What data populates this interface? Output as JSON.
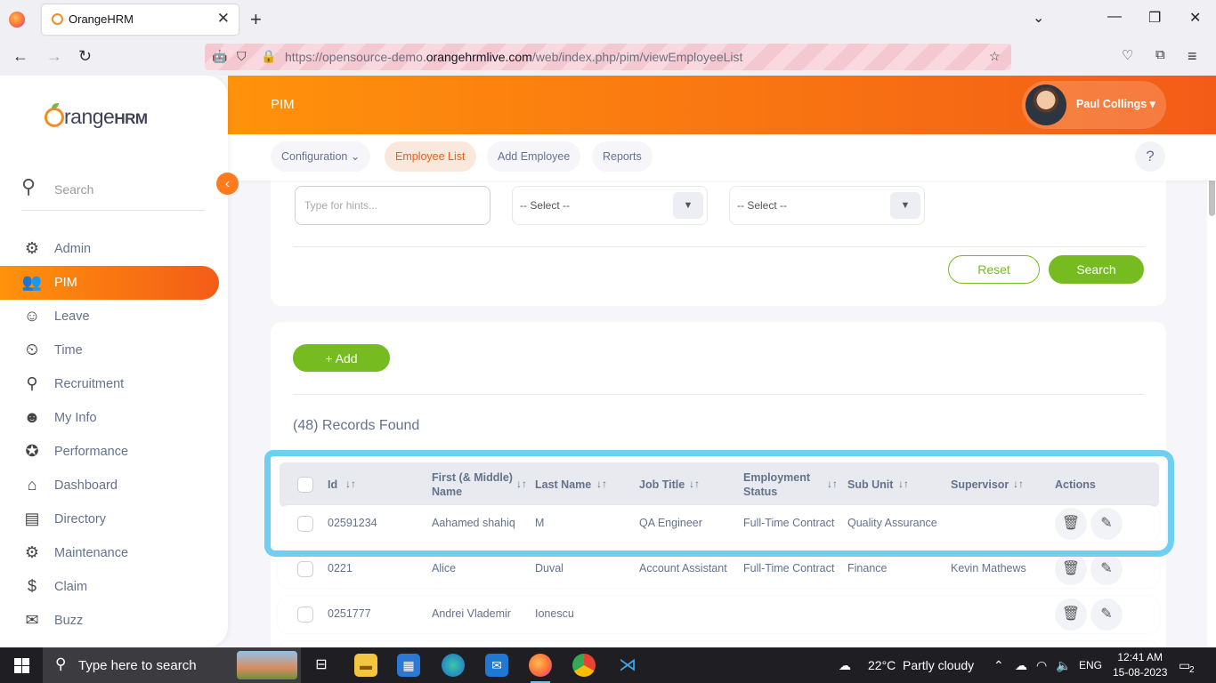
{
  "browser": {
    "tab_title": "OrangeHRM",
    "url_host_prefix": "https://opensource-demo.",
    "url_host": "orangehrmlive.com",
    "url_path": "/web/index.php/pim/viewEmployeeList"
  },
  "app": {
    "logo_main": "range",
    "logo_hrm": "HRM",
    "module_title": "PIM",
    "user_name": "Paul Collings",
    "sidebar": {
      "search_placeholder": "Search",
      "items": [
        {
          "label": "Admin",
          "icon": "admin-icon"
        },
        {
          "label": "PIM",
          "icon": "pim-icon"
        },
        {
          "label": "Leave",
          "icon": "leave-icon"
        },
        {
          "label": "Time",
          "icon": "time-icon"
        },
        {
          "label": "Recruitment",
          "icon": "recruitment-icon"
        },
        {
          "label": "My Info",
          "icon": "my-info-icon"
        },
        {
          "label": "Performance",
          "icon": "performance-icon"
        },
        {
          "label": "Dashboard",
          "icon": "dashboard-icon"
        },
        {
          "label": "Directory",
          "icon": "directory-icon"
        },
        {
          "label": "Maintenance",
          "icon": "maintenance-icon"
        },
        {
          "label": "Claim",
          "icon": "claim-icon"
        },
        {
          "label": "Buzz",
          "icon": "buzz-icon"
        }
      ],
      "active": "PIM"
    },
    "top_tabs": [
      {
        "label": "Configuration"
      },
      {
        "label": "Employee List"
      },
      {
        "label": "Add Employee"
      },
      {
        "label": "Reports"
      }
    ],
    "help": "?",
    "filters": {
      "hint_placeholder": "Type for hints...",
      "select1": "-- Select --",
      "select2": "-- Select --",
      "reset": "Reset",
      "search": "Search"
    },
    "add_button": "+  Add",
    "records_found": "(48) Records Found",
    "table": {
      "headers": {
        "id": "Id",
        "first_name_1": "First (& Middle)",
        "first_name_2": "Name",
        "last_name": "Last Name",
        "job_title": "Job Title",
        "employment_status_1": "Employment",
        "employment_status_2": "Status",
        "sub_unit": "Sub Unit",
        "supervisor": "Supervisor",
        "actions": "Actions"
      },
      "rows": [
        {
          "id": "02591234",
          "first": "Aahamed shahiq",
          "last": "M",
          "job": "QA Engineer",
          "status": "Full-Time Contract",
          "subunit": "Quality Assurance",
          "supervisor": ""
        },
        {
          "id": "0221",
          "first": "Alice",
          "last": "Duval",
          "job": "Account Assistant",
          "status": "Full-Time Contract",
          "subunit": "Finance",
          "supervisor": "Kevin Mathews"
        },
        {
          "id": "0251777",
          "first": "Andrei Vlademir",
          "last": "Ionescu",
          "job": "",
          "status": "",
          "subunit": "",
          "supervisor": ""
        }
      ]
    },
    "colors": {
      "accent": "#f35c17",
      "accent_light": "#ff920b",
      "green": "#76bc21",
      "highlight": "#6ecff0"
    }
  },
  "taskbar": {
    "search_placeholder": "Type here to search",
    "weather_temp": "22°C",
    "weather_text": "Partly cloudy",
    "lang": "ENG",
    "time": "12:41 AM",
    "date": "15-08-2023",
    "notifications": "2"
  }
}
